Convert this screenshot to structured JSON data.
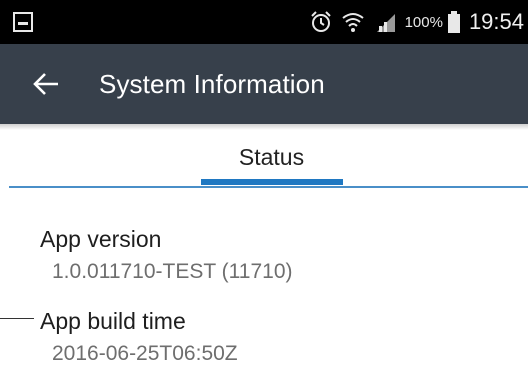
{
  "status_bar": {
    "battery": "100%",
    "time": "19:54",
    "icons": [
      "screenshot-icon",
      "alarm-icon",
      "wifi-icon",
      "signal-icon",
      "battery-icon"
    ]
  },
  "toolbar": {
    "title": "System Information",
    "back_icon": "arrow-left-icon",
    "background": "#37404b"
  },
  "tabs": {
    "active": "Status",
    "accent": "#1f78c2"
  },
  "fields": [
    {
      "label": "App version",
      "value": "1.0.011710-TEST (11710)"
    },
    {
      "label": "App build time",
      "value": "2016-06-25T06:50Z"
    }
  ]
}
